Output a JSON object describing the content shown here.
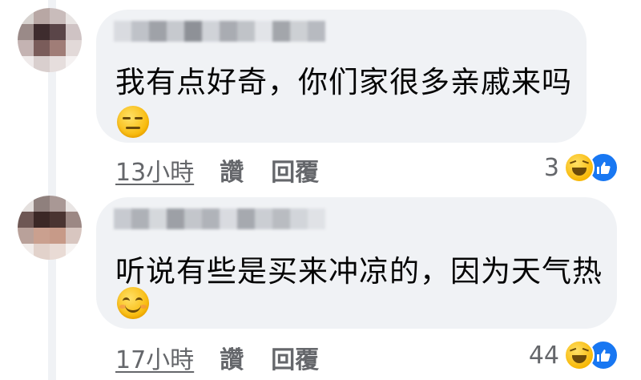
{
  "comments": [
    {
      "text": "我有点好奇，你们家很多亲戚来吗",
      "emoji_icon": "expressionless-face-icon",
      "time": "13小時",
      "like_label": "讚",
      "reply_label": "回覆",
      "reaction_count": "3",
      "reaction_icons": [
        "haha-icon",
        "like-icon"
      ]
    },
    {
      "text": "听说有些是买来冲凉的，因为天气热",
      "emoji_icon": "smiling-face-icon",
      "time": "17小時",
      "like_label": "讚",
      "reply_label": "回覆",
      "reaction_count": "44",
      "reaction_icons": [
        "haha-icon",
        "like-icon"
      ]
    }
  ],
  "colors": {
    "bubble": "#f0f2f5",
    "meta_text": "#65676b",
    "like_blue": "#1877f2",
    "emoji_yellow": "#f7b500"
  }
}
